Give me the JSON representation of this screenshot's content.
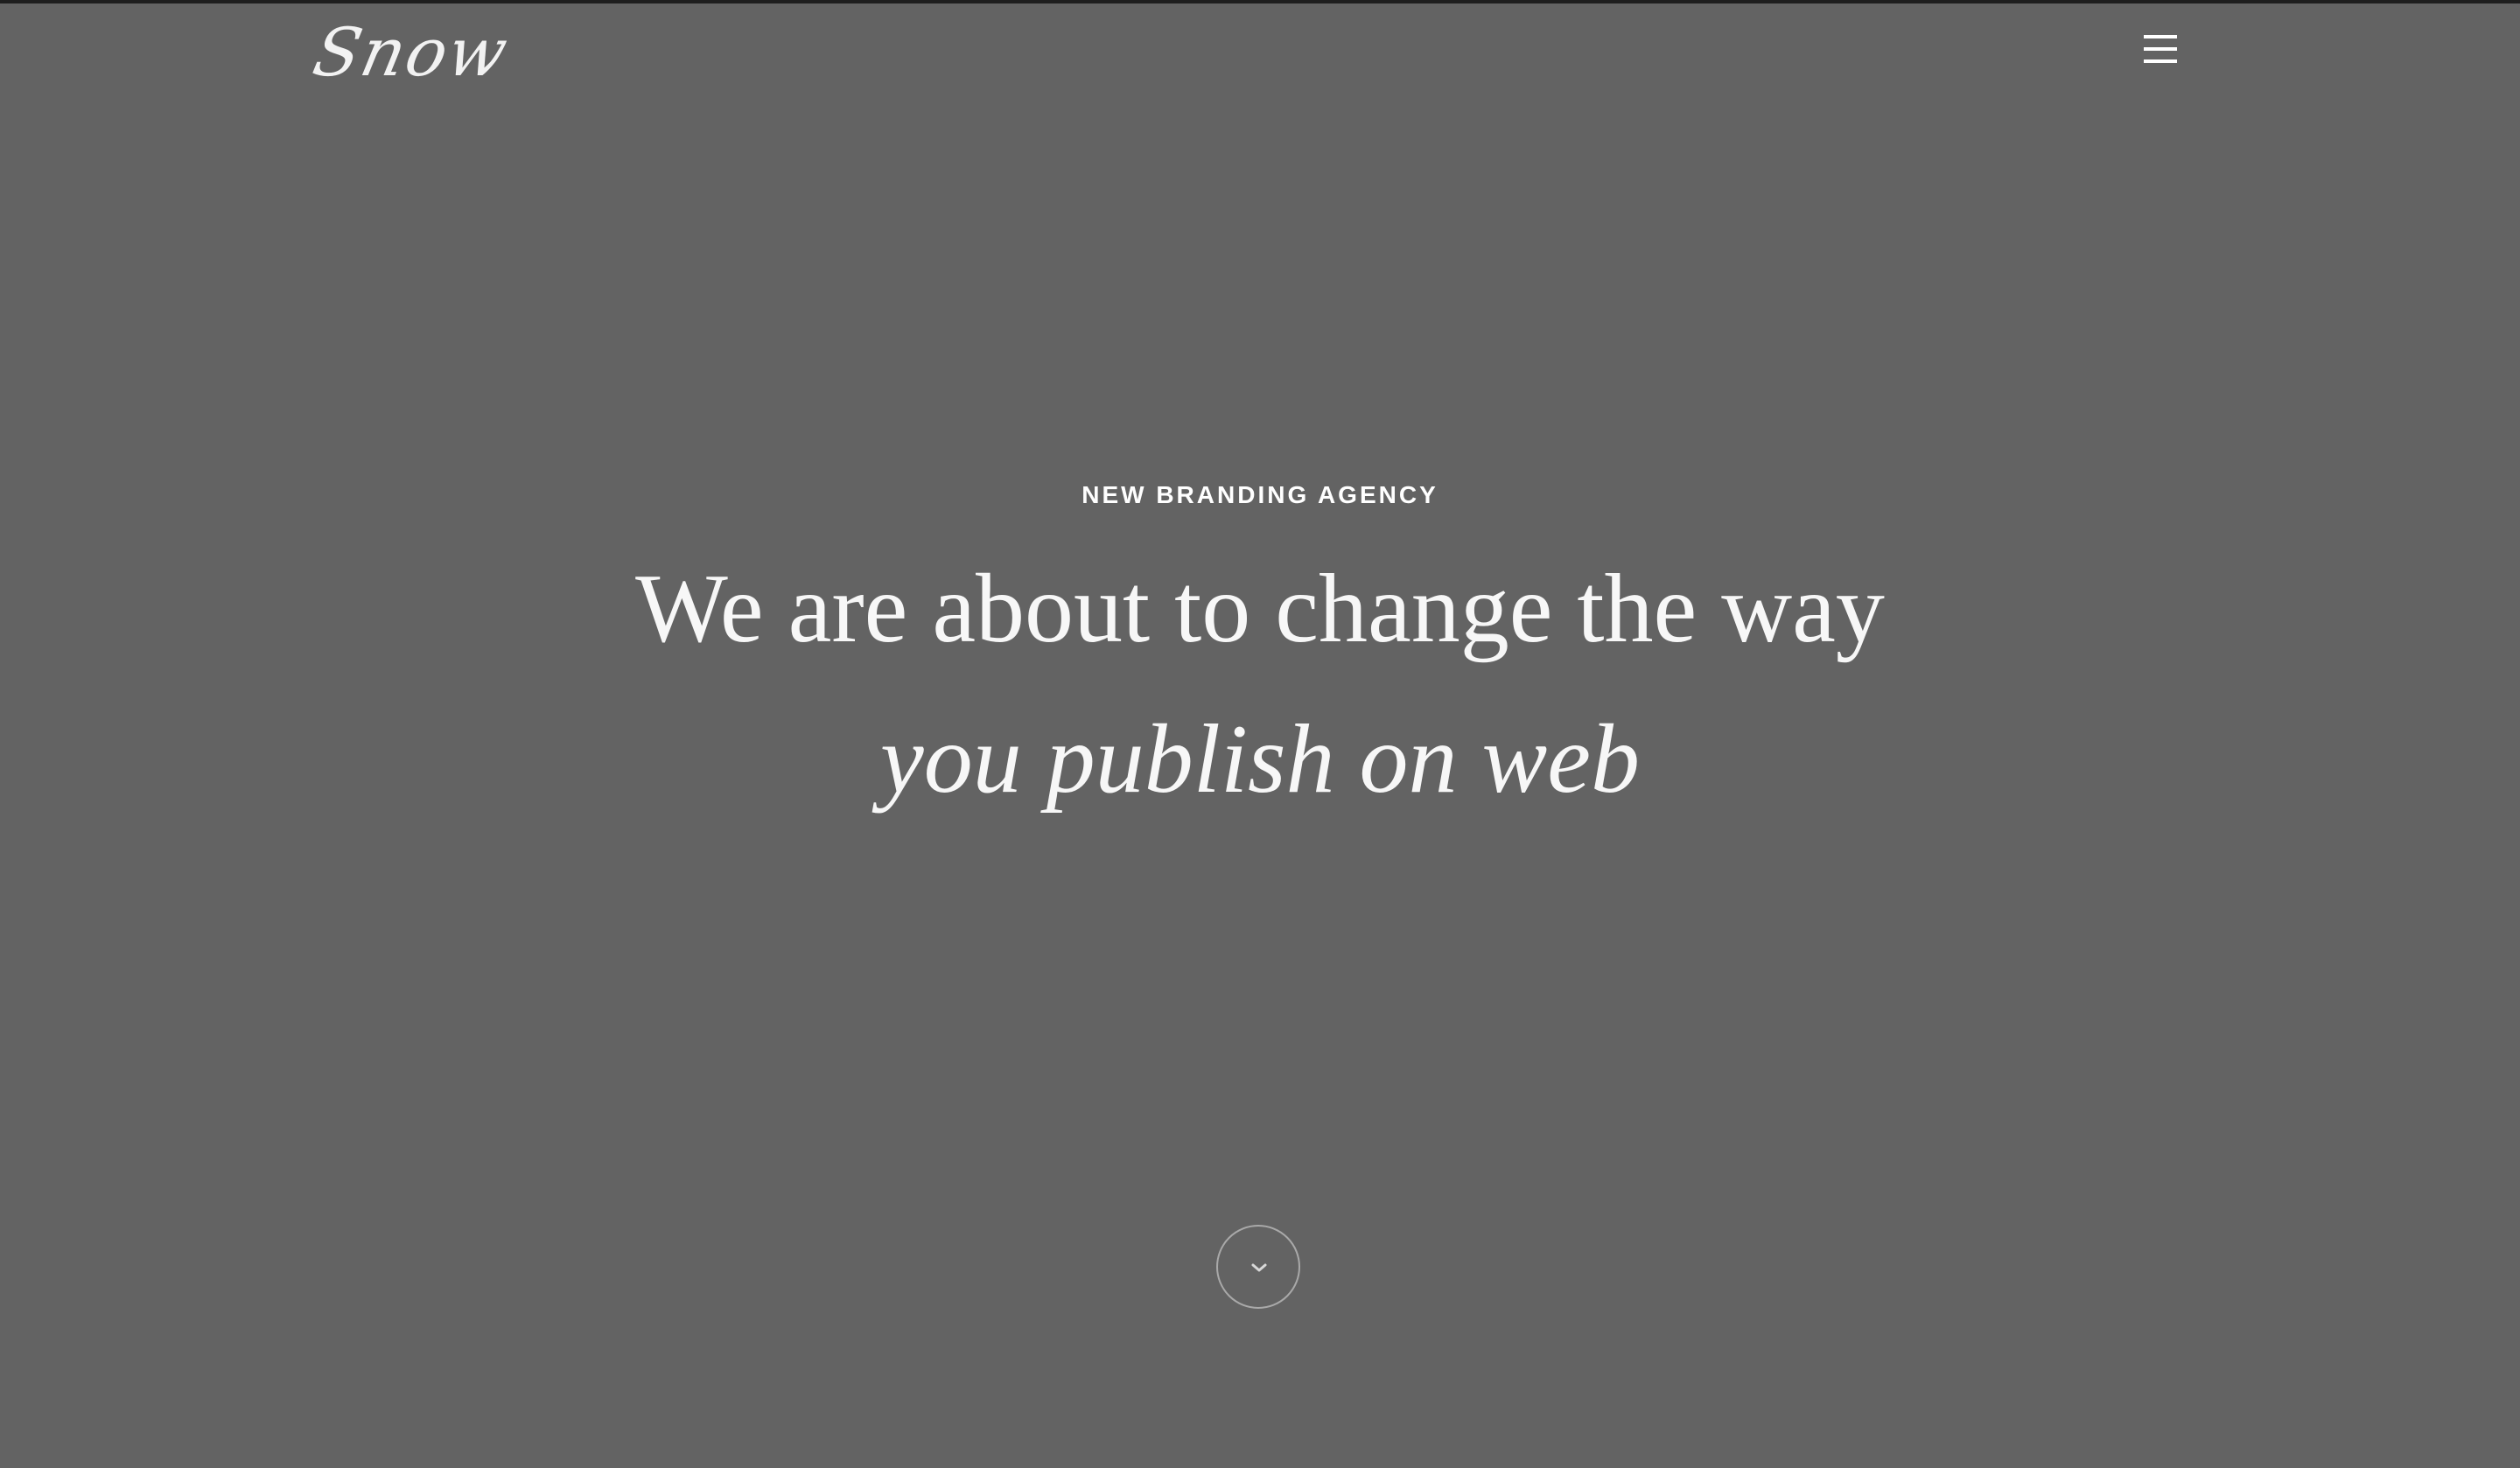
{
  "header": {
    "logo_text": "Snow",
    "menu_icon": "hamburger-menu-icon"
  },
  "hero": {
    "eyebrow": "NEW BRANDING AGENCY",
    "headline_line1": "We are about to change the way",
    "headline_line2": "you publish on web"
  },
  "scroll_down": {
    "icon": "chevron-down-icon"
  },
  "colors": {
    "background": "#636363",
    "text": "#ffffff",
    "top_border": "#1e1e1e",
    "scroll_circle_border": "#a9a9a9"
  }
}
